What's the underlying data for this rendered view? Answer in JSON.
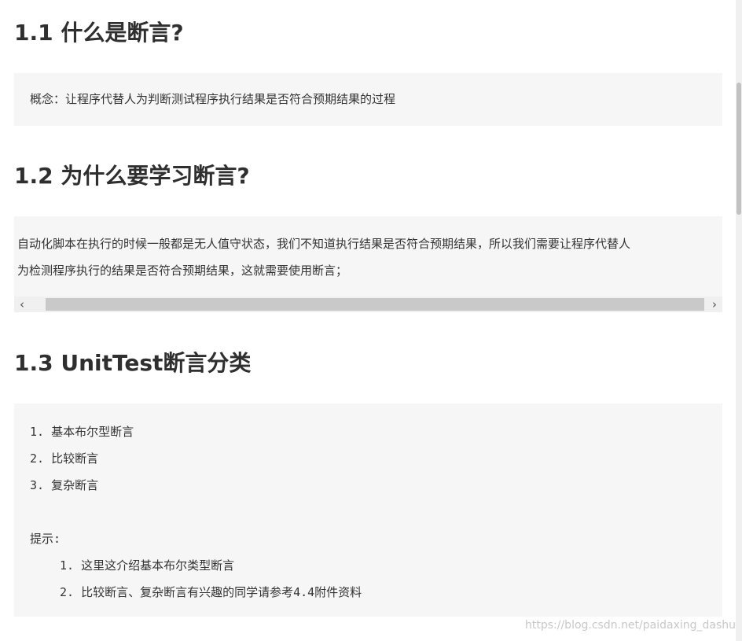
{
  "sections": [
    {
      "heading": "1.1 什么是断言?",
      "content": "概念：让程序代替人为判断测试程序执行结果是否符合预期结果的过程"
    },
    {
      "heading": "1.2 为什么要学习断言?",
      "content_lines": [
        "自动化脚本在执行的时候一般都是无人值守状态，我们不知道执行结果是否符合预期结果，所以我们需要让程序代替人",
        "为检测程序执行的结果是否符合预期结果，这就需要使用断言；"
      ]
    },
    {
      "heading": "1.3 UnitTest断言分类",
      "list": [
        "1. 基本布尔型断言",
        "2. 比较断言",
        "3. 复杂断言"
      ],
      "tip_label": "提示:",
      "tip_list": [
        "1. 这里这介绍基本布尔类型断言",
        "2. 比较断言、复杂断言有兴趣的同学请参考4.4附件资料"
      ]
    }
  ],
  "scrollbar": {
    "left_arrow": "‹",
    "right_arrow": "›"
  },
  "watermark": "https://blog.csdn.net/paidaxing_dashu"
}
